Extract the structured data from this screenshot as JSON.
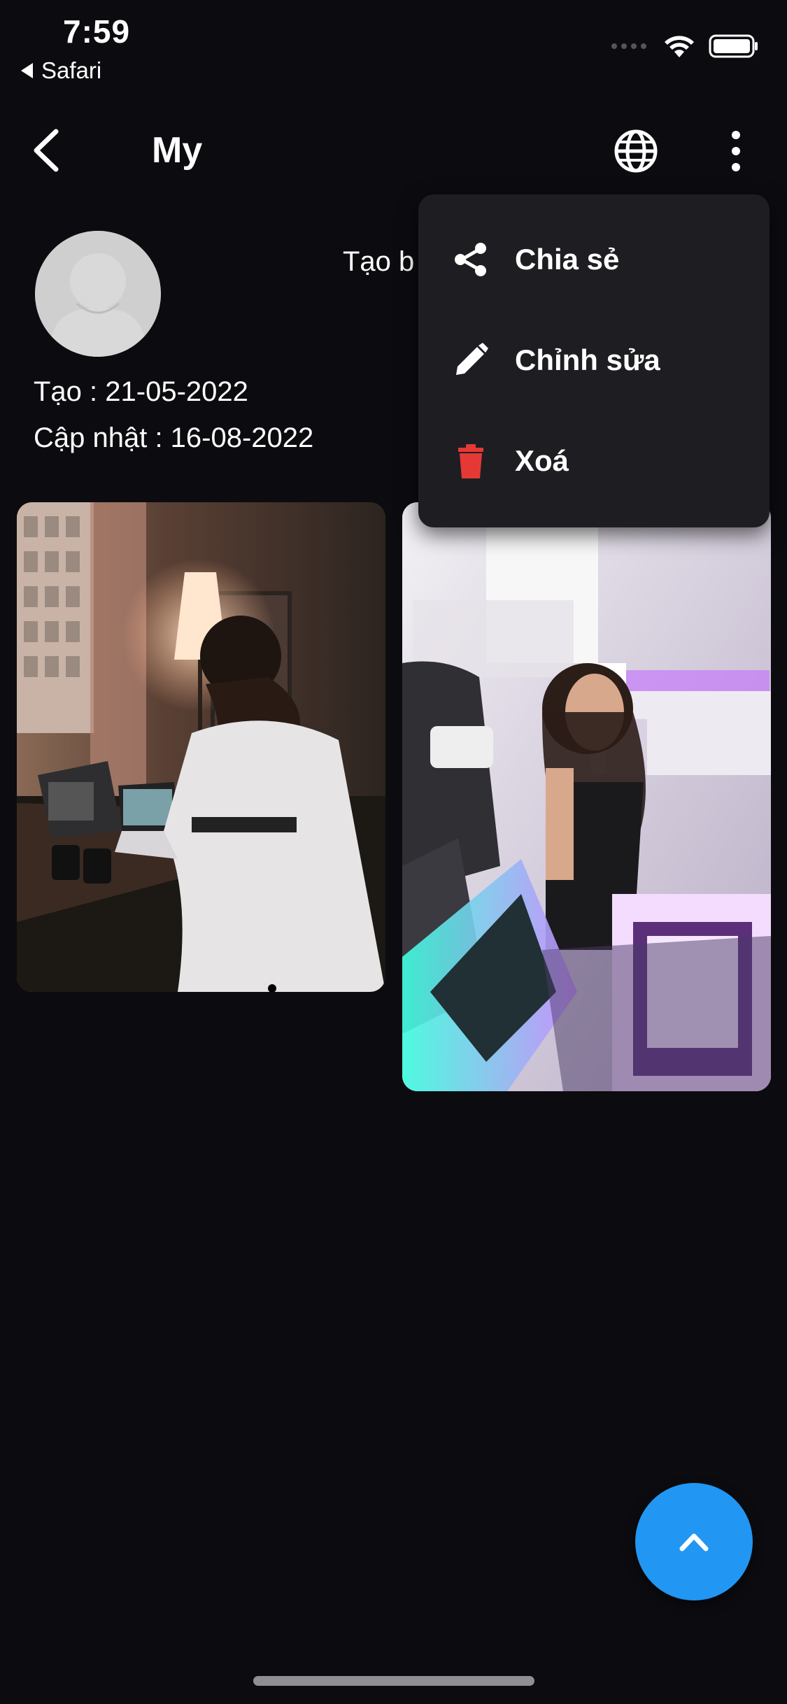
{
  "status_bar": {
    "time": "7:59",
    "back_app": "Safari"
  },
  "nav": {
    "title": "My",
    "icons": [
      "chevron-left-icon",
      "globe-icon",
      "more-vertical-icon"
    ]
  },
  "profile": {
    "created_by": "Tạo b",
    "created": "Tạo : 21-05-2022",
    "updated": "Cập nhật : 16-08-2022"
  },
  "menu": {
    "items": [
      {
        "label": "Chia sẻ",
        "icon": "share-icon",
        "color": "#ffffff"
      },
      {
        "label": "Chỉnh sửa",
        "icon": "pencil-icon",
        "color": "#ffffff"
      },
      {
        "label": "Xoá",
        "icon": "trash-icon",
        "color": "#e53935"
      }
    ]
  },
  "photos": [
    {
      "description_icon": "photo-man-laptop"
    },
    {
      "description_icon": "photo-woman-gaming-desk"
    }
  ],
  "fab": {
    "icon": "chevron-up-icon",
    "color": "#2196f3"
  }
}
